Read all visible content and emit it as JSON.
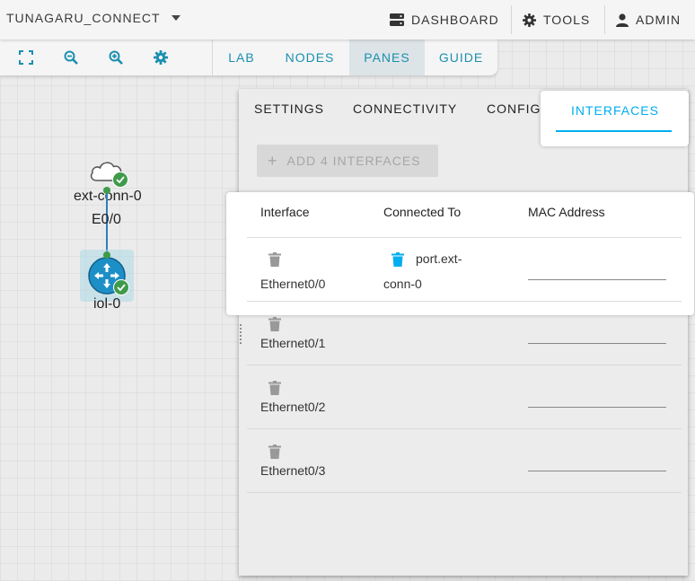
{
  "topbar": {
    "lab_title": "TUNAGARU_CONNECT",
    "dashboard_label": "DASHBOARD",
    "tools_label": "TOOLS",
    "admin_label": "ADMIN"
  },
  "toolbar": {
    "icons": [
      "fit-screen-icon",
      "zoom-out-icon",
      "zoom-in-icon",
      "gear-icon"
    ],
    "tabs": [
      "LAB",
      "NODES",
      "PANES",
      "GUIDE"
    ],
    "active_tab": "PANES"
  },
  "canvas": {
    "nodes": [
      {
        "label": "ext-conn-0",
        "type": "cloud-icon",
        "status": "started"
      },
      {
        "label": "iol-0",
        "type": "router-icon",
        "status": "started"
      }
    ],
    "link_label": "E0/0"
  },
  "panel": {
    "tabs": [
      "SETTINGS",
      "CONNECTIVITY",
      "CONFIG",
      "INTERFACES"
    ],
    "active_tab": "INTERFACES",
    "add_button_label": "ADD 4 INTERFACES",
    "columns": [
      "Interface",
      "Connected To",
      "MAC Address"
    ],
    "rows": [
      {
        "name": "Ethernet0/0",
        "connected_to_line1": "port.ext-",
        "connected_to_line2": "conn-0"
      },
      {
        "name": "Ethernet0/1"
      },
      {
        "name": "Ethernet0/2"
      },
      {
        "name": "Ethernet0/3"
      }
    ]
  },
  "colors": {
    "accent": "#1a8fb0",
    "active_tab_text": "#00aeef",
    "status_green": "#3f9b4b",
    "link_blue": "#2b7fc2",
    "router_blue": "#1d8fc7"
  }
}
